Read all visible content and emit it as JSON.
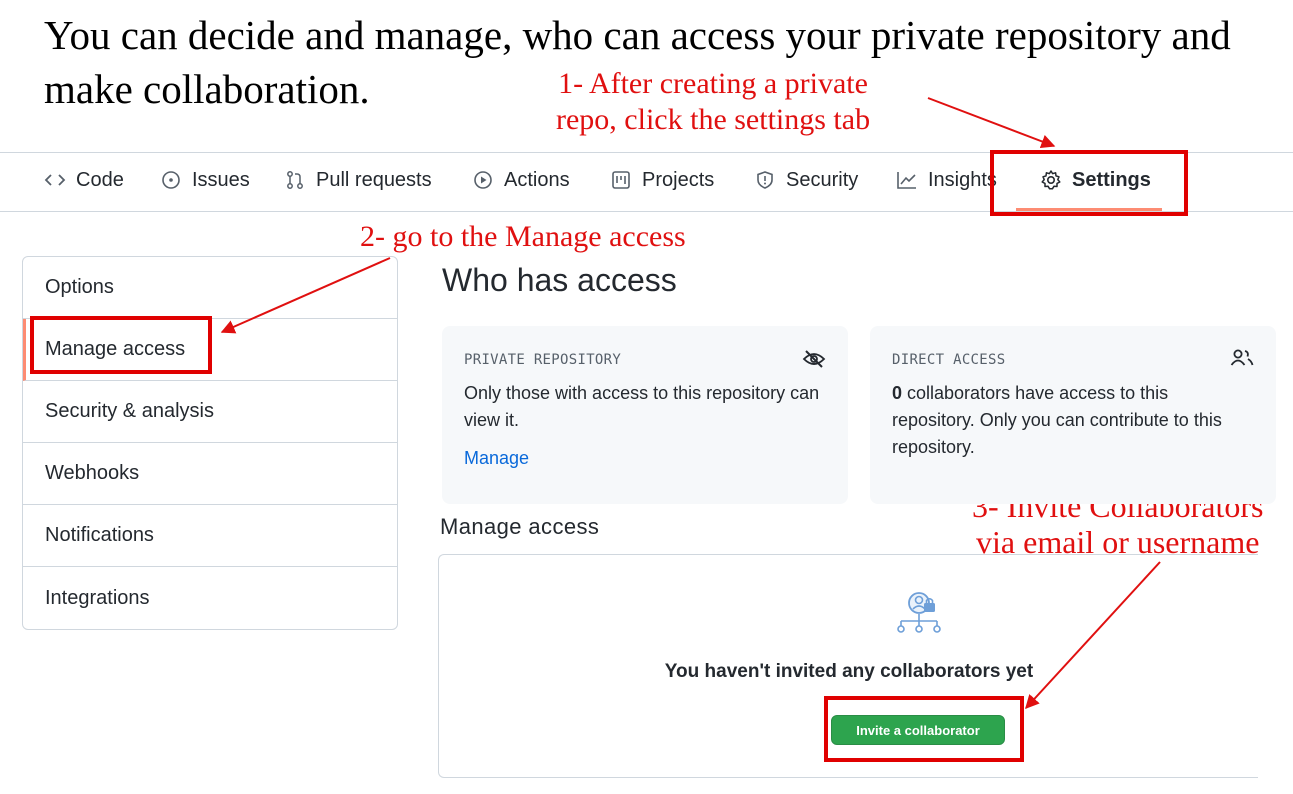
{
  "intro_text": "You can decide and manage, who can access your private repository and make collaboration.",
  "annotations": {
    "step1_line1": "1- After creating a private",
    "step1_line2": "repo, click the settings tab",
    "step2": "2- go to the Manage access",
    "step3_line1": "3- Invite Collaborators",
    "step3_line2": "via email or username"
  },
  "tabs": [
    {
      "label": "Code",
      "icon": "code-icon"
    },
    {
      "label": "Issues",
      "icon": "issue-icon"
    },
    {
      "label": "Pull requests",
      "icon": "pull-request-icon"
    },
    {
      "label": "Actions",
      "icon": "play-icon"
    },
    {
      "label": "Projects",
      "icon": "project-icon"
    },
    {
      "label": "Security",
      "icon": "shield-icon"
    },
    {
      "label": "Insights",
      "icon": "graph-icon"
    },
    {
      "label": "Settings",
      "icon": "gear-icon",
      "active": true
    }
  ],
  "sidebar": {
    "items": [
      {
        "label": "Options"
      },
      {
        "label": "Manage access",
        "active": true
      },
      {
        "label": "Security & analysis"
      },
      {
        "label": "Webhooks"
      },
      {
        "label": "Notifications"
      },
      {
        "label": "Integrations"
      }
    ]
  },
  "main": {
    "title": "Who has access",
    "private_card": {
      "title": "PRIVATE REPOSITORY",
      "text": "Only those with access to this repository can view it.",
      "link": "Manage",
      "icon": "eye-closed-icon"
    },
    "direct_card": {
      "title": "DIRECT ACCESS",
      "count": "0",
      "text": " collaborators have access to this repository. Only you can contribute to this repository.",
      "icon": "people-icon"
    },
    "manage_heading": "Manage access",
    "empty_message": "You haven't invited any collaborators yet",
    "invite_button": "Invite a collaborator"
  },
  "colors": {
    "annotation": "#e01010",
    "accent_underline": "#fd8c73",
    "link": "#0969da",
    "button_green": "#2da44e"
  }
}
